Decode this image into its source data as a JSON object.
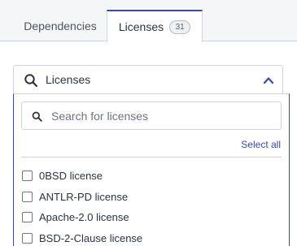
{
  "tabs": {
    "dependencies": {
      "label": "Dependencies"
    },
    "licenses": {
      "label": "Licenses",
      "count": "31"
    }
  },
  "dropdown": {
    "title": "Licenses",
    "search_placeholder": "Search for licenses",
    "select_all_label": "Select all",
    "items": [
      {
        "label": "0BSD license",
        "checked": false
      },
      {
        "label": "ANTLR-PD license",
        "checked": false
      },
      {
        "label": "Apache-2.0 license",
        "checked": false
      },
      {
        "label": "BSD-2-Clause license",
        "checked": false
      }
    ]
  },
  "colors": {
    "accent": "#3d4a9e",
    "border": "#cfd4da",
    "tabbar_bg": "#f5f6f7"
  },
  "icons": {
    "header_search": "search-icon",
    "chevron": "chevron-up-icon",
    "input_search": "search-icon"
  }
}
